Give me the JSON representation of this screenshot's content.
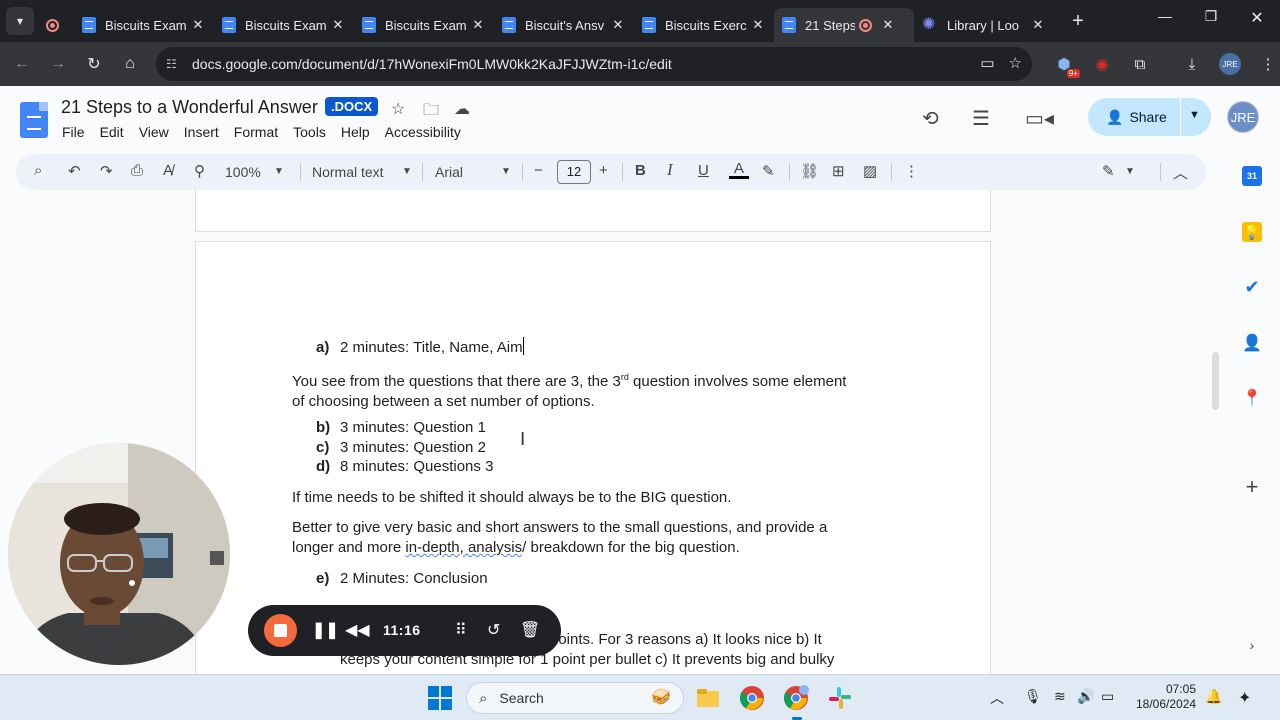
{
  "browser": {
    "tabs": [
      {
        "title": "Biscuits Exam"
      },
      {
        "title": "Biscuits Exam"
      },
      {
        "title": "Biscuits Exam"
      },
      {
        "title": "Biscuit's Ansv"
      },
      {
        "title": "Biscuits Exerc"
      },
      {
        "title": "21 Steps"
      },
      {
        "title": "Library | Loo"
      }
    ],
    "url": "docs.google.com/document/d/17hWonexiFm0LMW0kk2KaJFJJWZtm-i1c/edit",
    "extension_badge": "9+",
    "profile_initials": "JRE"
  },
  "docs": {
    "title": "21 Steps to a Wonderful Answer",
    "file_badge": ".DOCX",
    "menu": [
      "File",
      "Edit",
      "View",
      "Insert",
      "Format",
      "Tools",
      "Help",
      "Accessibility"
    ],
    "share_label": "Share",
    "avatar_initials": "JRE"
  },
  "format_toolbar": {
    "zoom": "100%",
    "style": "Normal text",
    "font": "Arial",
    "font_size": "12",
    "bold": "B",
    "italic": "I",
    "underline": "U",
    "text_color": "A"
  },
  "document": {
    "item_a": {
      "label": "a)",
      "text": "2 minutes: Title, Name, Aim"
    },
    "para1_before": "You see from the questions that there are 3, the 3",
    "para1_sup": "rd",
    "para1_after": " question involves some element",
    "para1_line2": "of choosing between a set number of options.",
    "item_b": {
      "label": "b)",
      "text": "3 minutes: Question 1"
    },
    "item_c": {
      "label": "c)",
      "text": "3 minutes: Question 2"
    },
    "item_d": {
      "label": "d)",
      "text": "8 minutes: Questions 3"
    },
    "para2": "If time needs to be shifted it should always be to the BIG question.",
    "para3_line1": "Better to give very basic and short answers to the small questions, and provide a",
    "para3_line2_a": "longer and more ",
    "para3_line2_squiggle": "in-depth, analysis",
    "para3_line2_b": "/ breakdown for the big question.",
    "item_e": {
      "label": "e)",
      "text": "2 Minutes: Conclusion"
    },
    "partial_line1": "points. For 3 reasons a) It looks nice b) It",
    "partial_line2": "keeps your content simple for 1 point per bullet c) It prevents big and bulky"
  },
  "recorder": {
    "time": "11:16"
  },
  "taskbar": {
    "search_placeholder": "Search",
    "time": "07:05",
    "date": "18/06/2024"
  }
}
